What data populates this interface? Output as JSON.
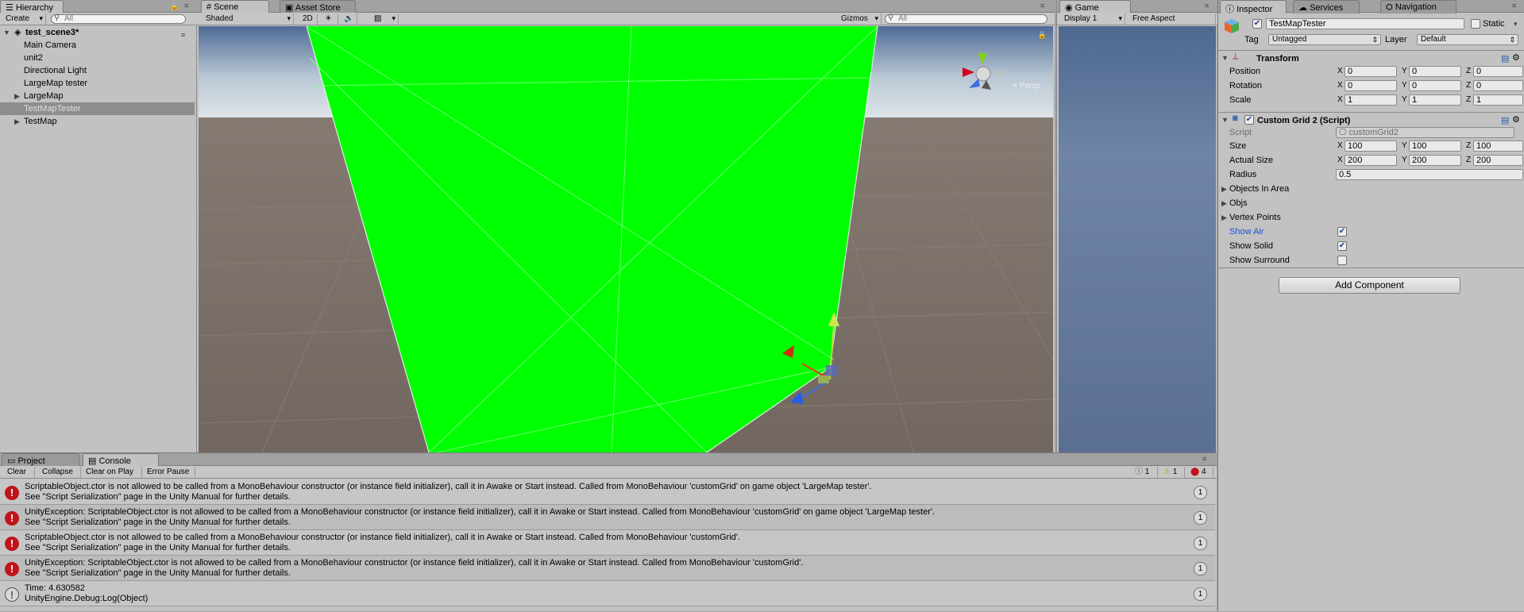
{
  "hierarchy": {
    "tab": "Hierarchy",
    "create_label": "Create",
    "search_placeholder": "All",
    "scene_name": "test_scene3*",
    "items": [
      {
        "label": "Main Camera"
      },
      {
        "label": "unit2"
      },
      {
        "label": "Directional Light"
      },
      {
        "label": "LargeMap tester"
      },
      {
        "label": "LargeMap",
        "foldout": true
      },
      {
        "label": "TestMapTester",
        "selected": true
      },
      {
        "label": "TestMap",
        "foldout": true
      }
    ]
  },
  "scene": {
    "tabs": [
      "Scene",
      "Asset Store"
    ],
    "shading": "Shaded",
    "mode_2d": "2D",
    "gizmos_label": "Gizmos",
    "search_placeholder": "All",
    "persp_label": "Persp"
  },
  "game": {
    "tab": "Game",
    "display": "Display 1",
    "aspect": "Free Aspect"
  },
  "inspector": {
    "tabs": [
      "Inspector",
      "Services",
      "Navigation"
    ],
    "object_name": "TestMapTester",
    "static_label": "Static",
    "tag_label": "Tag",
    "tag_value": "Untagged",
    "layer_label": "Layer",
    "layer_value": "Default",
    "transform": {
      "title": "Transform",
      "rows": [
        {
          "label": "Position",
          "x": "0",
          "y": "0",
          "z": "0"
        },
        {
          "label": "Rotation",
          "x": "0",
          "y": "0",
          "z": "0"
        },
        {
          "label": "Scale",
          "x": "1",
          "y": "1",
          "z": "1"
        }
      ]
    },
    "custom_grid": {
      "title": "Custom Grid 2 (Script)",
      "script_label": "Script",
      "script_value": "customGrid2",
      "size_label": "Size",
      "size": {
        "x": "100",
        "y": "100",
        "z": "100"
      },
      "actual_size_label": "Actual Size",
      "actual_size": {
        "x": "200",
        "y": "200",
        "z": "200"
      },
      "radius_label": "Radius",
      "radius_value": "0.5",
      "foldouts": [
        "Objects In Area",
        "Objs",
        "Vertex Points"
      ],
      "toggles": [
        {
          "label": "Show Air",
          "checked": true,
          "highlight": true
        },
        {
          "label": "Show Solid",
          "checked": true
        },
        {
          "label": "Show Surround",
          "checked": false
        }
      ]
    },
    "add_component": "Add Component",
    "axis_labels": [
      "X",
      "Y",
      "Z"
    ]
  },
  "console": {
    "tabs": [
      "Project",
      "Console"
    ],
    "buttons": [
      "Clear",
      "Collapse",
      "Clear on Play",
      "Error Pause"
    ],
    "counts": {
      "info": "1",
      "warn": "1",
      "error": "4"
    },
    "entries": [
      {
        "type": "error",
        "line1": "ScriptableObject.ctor is not allowed to be called from a MonoBehaviour constructor (or instance field initializer), call it in Awake or Start instead. Called from MonoBehaviour 'customGrid' on game object 'LargeMap tester'.",
        "line2": "See \"Script Serialization\" page in the Unity Manual for further details.",
        "count": "1"
      },
      {
        "type": "error",
        "line1": "UnityException: ScriptableObject.ctor is not allowed to be called from a MonoBehaviour constructor (or instance field initializer), call it in Awake or Start instead. Called from MonoBehaviour 'customGrid' on game object 'LargeMap tester'.",
        "line2": "See \"Script Serialization\" page in the Unity Manual for further details.",
        "count": "1"
      },
      {
        "type": "error",
        "line1": "ScriptableObject.ctor is not allowed to be called from a MonoBehaviour constructor (or instance field initializer), call it in Awake or Start instead. Called from MonoBehaviour 'customGrid'.",
        "line2": "See \"Script Serialization\" page in the Unity Manual for further details.",
        "count": "1"
      },
      {
        "type": "error",
        "line1": "UnityException: ScriptableObject.ctor is not allowed to be called from a MonoBehaviour constructor (or instance field initializer), call it in Awake or Start instead. Called from MonoBehaviour 'customGrid'.",
        "line2": "See \"Script Serialization\" page in the Unity Manual for further details.",
        "count": "1"
      },
      {
        "type": "info",
        "line1": "Time: 4.630582",
        "line2": "UnityEngine.Debug:Log(Object)",
        "count": "1"
      }
    ]
  },
  "colors": {
    "mesh_green": "#00ff00",
    "sky": "#c8d4dc",
    "ground": "#7a7069",
    "game_bg": "#5c7396",
    "error_red": "#c0141b",
    "link_blue": "#1f4fd6"
  }
}
